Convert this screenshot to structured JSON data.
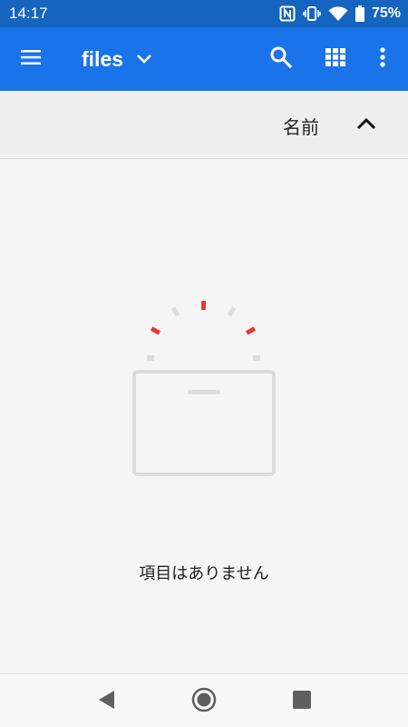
{
  "status_bar": {
    "time": "14:17",
    "icons": [
      "nfc-icon",
      "vibrate-icon",
      "wifi-icon",
      "battery-icon"
    ],
    "battery_percent": "75%"
  },
  "app_bar": {
    "title": "files",
    "icons": [
      "menu-icon",
      "dropdown-icon",
      "search-icon",
      "grid-view-icon",
      "more-vert-icon"
    ],
    "color": "#1a73e8"
  },
  "sort_bar": {
    "label": "名前",
    "direction_icon": "chevron-up-icon"
  },
  "empty_state": {
    "message": "項目はありません",
    "illustration": "empty-box-icon",
    "accent_color": "#e53935"
  },
  "nav_bar": {
    "icons": [
      "back-icon",
      "home-icon",
      "recents-icon"
    ]
  }
}
